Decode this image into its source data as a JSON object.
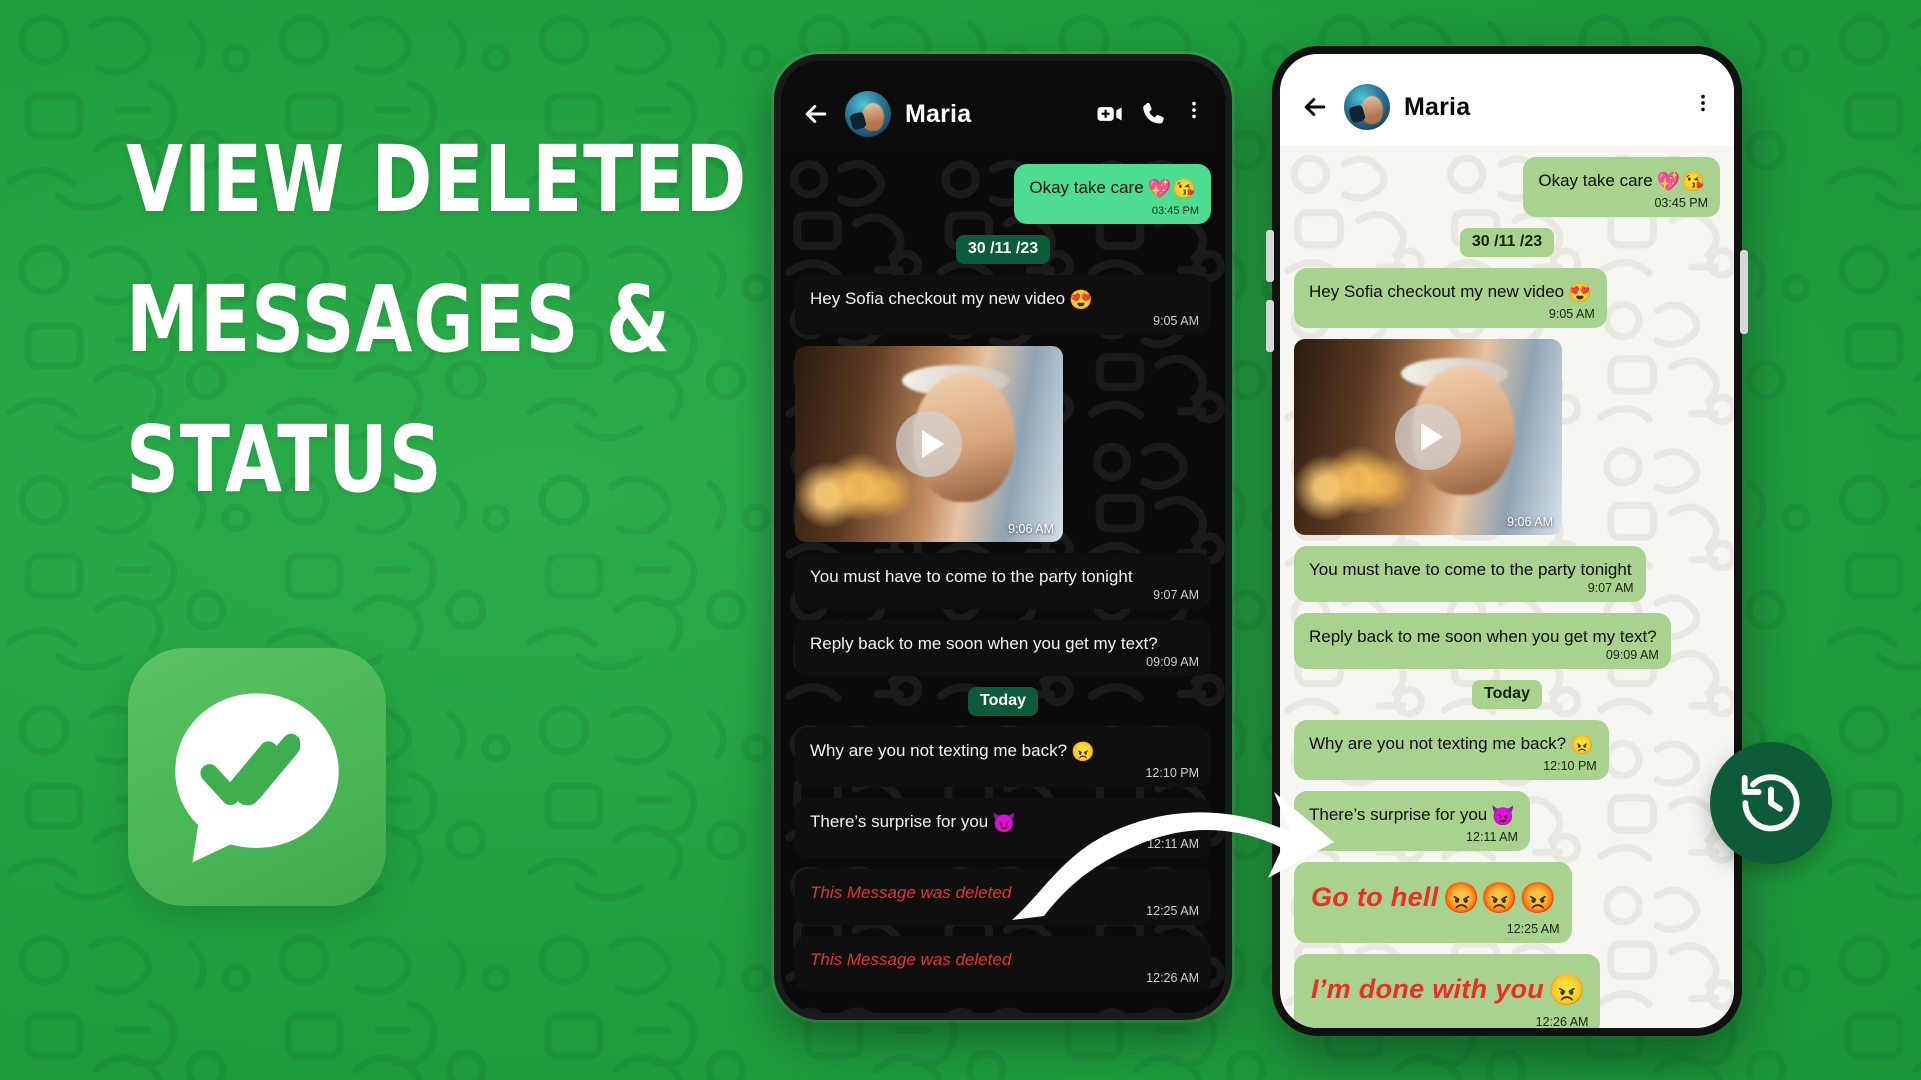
{
  "theme": {
    "brand_green": "#21a040",
    "icon_green": "#4cb957",
    "deleted_red": "#e4352c",
    "dark_bubble_out": "#4ddc90",
    "light_bubble": "#a9d28e",
    "fab_green": "#0d5c37"
  },
  "promo": {
    "headline_lines": [
      "VIEW DELETED",
      "MESSAGES &",
      "STATUS"
    ],
    "app_icon_name": "whatsapp-double-check-bubble-icon"
  },
  "phone_dark": {
    "header": {
      "back_icon": "back-arrow-icon",
      "contact_name": "Maria",
      "avatar": "contact-avatar",
      "video_call_icon": "video-call-icon",
      "voice_call_icon": "phone-call-icon",
      "menu_icon": "overflow-menu-icon"
    },
    "messages": [
      {
        "kind": "bubble",
        "side": "out",
        "text": "Okay take care",
        "emoji": "💖😘",
        "time": "03:45 PM"
      },
      {
        "kind": "chip",
        "text": "30 /11 /23"
      },
      {
        "kind": "bubble",
        "side": "in",
        "text": "Hey Sofia checkout my new video",
        "emoji": "😍",
        "time": "9:05 AM"
      },
      {
        "kind": "video",
        "time": "9:06 AM"
      },
      {
        "kind": "bubble",
        "side": "in",
        "text": "You must have to come to the party tonight",
        "emoji": "",
        "time": "9:07 AM"
      },
      {
        "kind": "bubble",
        "side": "in",
        "text": "Reply back to me soon when you get my text?",
        "emoji": "",
        "time": "09:09 AM"
      },
      {
        "kind": "chip",
        "text": "Today"
      },
      {
        "kind": "bubble",
        "side": "in",
        "text": "Why are you not texting me back?",
        "emoji": "😠",
        "time": "12:10 PM"
      },
      {
        "kind": "bubble",
        "side": "in",
        "text": "There’s surprise for you",
        "emoji": "😈",
        "time": "12:11 AM"
      },
      {
        "kind": "deleted",
        "side": "in",
        "text": "This Message was deleted",
        "emoji": "",
        "time": "12:25 AM"
      },
      {
        "kind": "deleted",
        "side": "in",
        "text": "This Message was deleted",
        "emoji": "",
        "time": "12:26 AM"
      }
    ]
  },
  "phone_light": {
    "header": {
      "back_icon": "back-arrow-icon",
      "contact_name": "Maria",
      "avatar": "contact-avatar",
      "menu_icon": "overflow-menu-icon"
    },
    "messages": [
      {
        "kind": "bubble",
        "side": "out",
        "text": "Okay take care",
        "emoji": "💖😘",
        "time": "03:45 PM"
      },
      {
        "kind": "chip",
        "text": "30 /11 /23"
      },
      {
        "kind": "bubble",
        "side": "in",
        "text": "Hey Sofia checkout my new video",
        "emoji": "😍",
        "time": "9:05 AM"
      },
      {
        "kind": "video",
        "time": "9:06 AM"
      },
      {
        "kind": "bubble",
        "side": "in",
        "text": "You must have to come to the party tonight",
        "emoji": "",
        "time": "9:07 AM"
      },
      {
        "kind": "bubble",
        "side": "in",
        "text": "Reply back to me soon when you get my text?",
        "emoji": "",
        "time": "09:09 AM"
      },
      {
        "kind": "chip",
        "text": "Today"
      },
      {
        "kind": "bubble",
        "side": "in",
        "text": "Why are you not texting me back?",
        "emoji": "😠",
        "time": "12:10 PM"
      },
      {
        "kind": "bubble",
        "side": "in",
        "text": "There’s surprise for you",
        "emoji": "😈",
        "time": "12:11 AM"
      },
      {
        "kind": "revealed",
        "side": "in",
        "text": "Go to hell",
        "emoji": "😡😡😡",
        "time": "12:25 AM"
      },
      {
        "kind": "revealed",
        "side": "in",
        "text": "I’m done with you",
        "emoji": "😠",
        "time": "12:26 AM"
      }
    ],
    "fab": {
      "icon": "restore-history-icon"
    }
  },
  "annotation": {
    "arrow": "curved-swoosh-arrow"
  }
}
